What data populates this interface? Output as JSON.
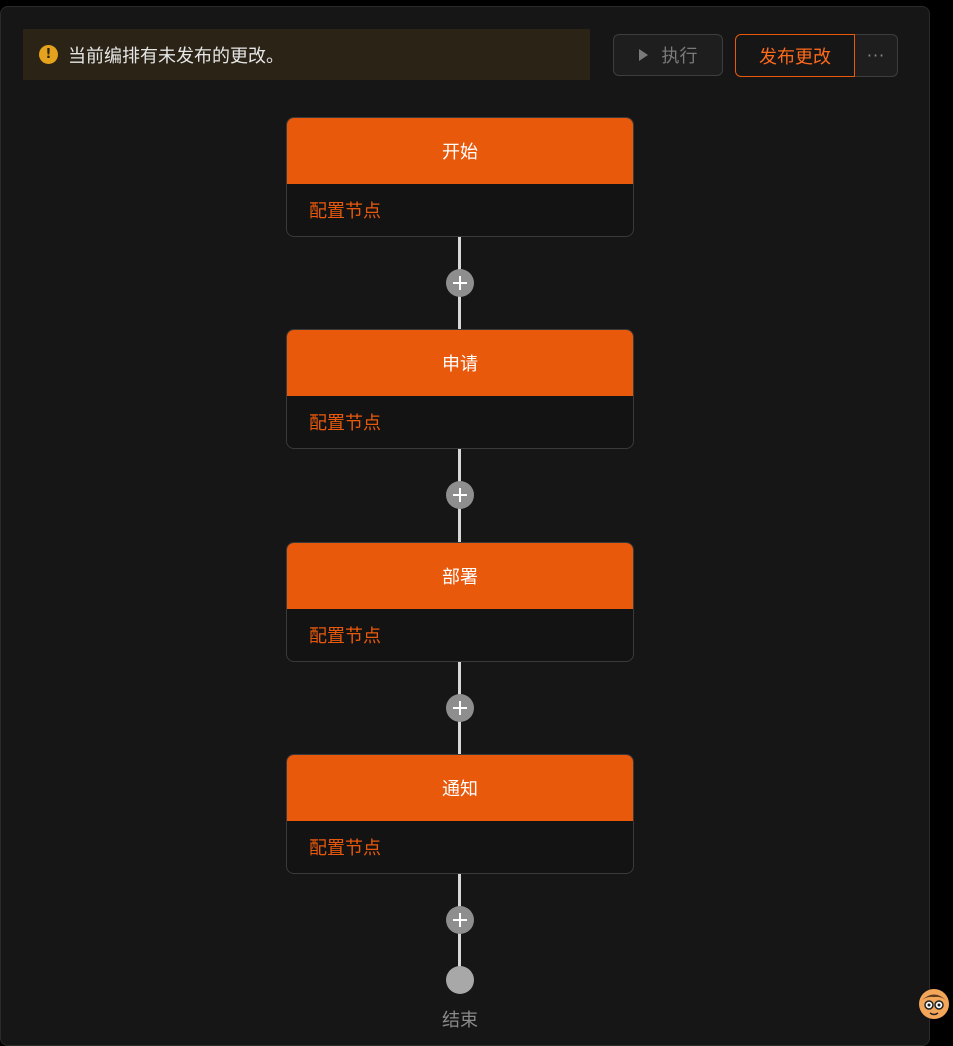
{
  "banner": {
    "icon": "warning-icon",
    "message": "当前编排有未发布的更改。"
  },
  "toolbar": {
    "run_label": "执行",
    "publish_label": "发布更改",
    "more_label": "···"
  },
  "nodes": [
    {
      "title": "开始",
      "action": "配置节点"
    },
    {
      "title": "申请",
      "action": "配置节点"
    },
    {
      "title": "部署",
      "action": "配置节点"
    },
    {
      "title": "通知",
      "action": "配置节点"
    }
  ],
  "end_label": "结束",
  "colors": {
    "accent": "#e8590c",
    "warning": "#e5a21c",
    "background": "#161616"
  }
}
